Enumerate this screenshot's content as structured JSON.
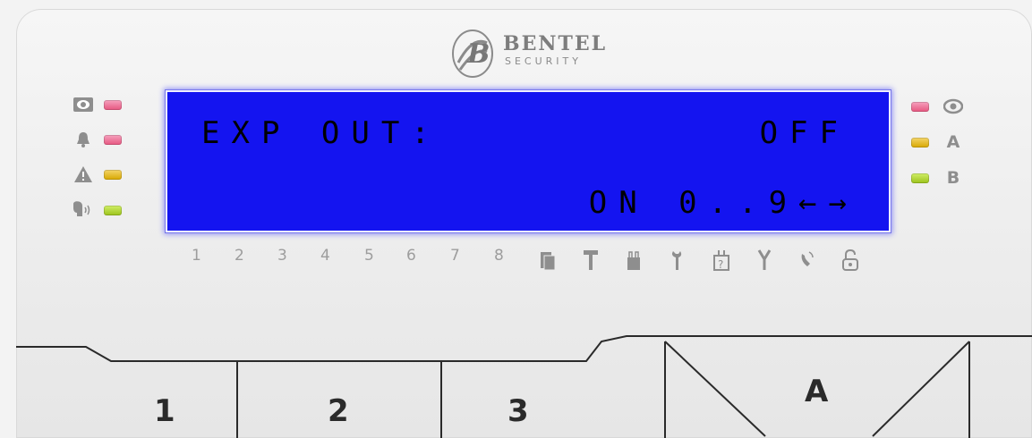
{
  "brand": {
    "name": "BENTEL",
    "sub": "SECURITY"
  },
  "lcd": {
    "line1_left": "EXP OUT:",
    "line1_right": "OFF",
    "line2_right": "ON 0..9←→"
  },
  "left_leds": [
    {
      "icon": "eye-closed-icon",
      "color": "red"
    },
    {
      "icon": "bell-icon",
      "color": "red"
    },
    {
      "icon": "warning-icon",
      "color": "amber"
    },
    {
      "icon": "speaker-voice-icon",
      "color": "green"
    }
  ],
  "right_leds": [
    {
      "label": "",
      "icon": "eye-icon",
      "color": "red"
    },
    {
      "label": "A",
      "color": "amber"
    },
    {
      "label": "B",
      "color": "green"
    }
  ],
  "zones": [
    "1",
    "2",
    "3",
    "4",
    "5",
    "6",
    "7",
    "8"
  ],
  "status_icons": [
    "tamper-icon",
    "hammer-icon",
    "battery-icon",
    "wrench-icon",
    "box-question-icon",
    "tool-icon",
    "phone-icon",
    "padlock-icon"
  ],
  "keys": [
    "1",
    "2",
    "3",
    "A"
  ],
  "colors": {
    "lcd_background": "#1414f0",
    "led_red": "#e6557f",
    "led_amber": "#d7a800",
    "led_green": "#9bc21a"
  }
}
